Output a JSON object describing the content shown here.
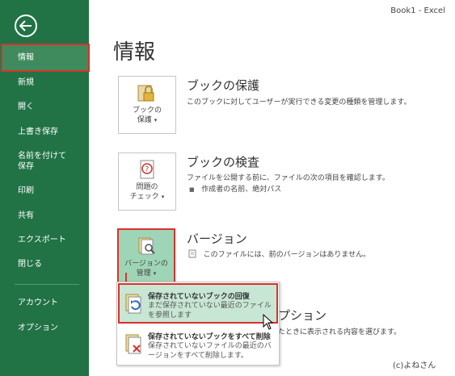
{
  "window": {
    "title": "Book1 - Excel"
  },
  "sidebar": {
    "items": [
      {
        "label": "情報"
      },
      {
        "label": "新規"
      },
      {
        "label": "開く"
      },
      {
        "label": "上書き保存"
      },
      {
        "label": "名前を付けて"
      },
      {
        "label": "保存"
      },
      {
        "label": "印刷"
      },
      {
        "label": "共有"
      },
      {
        "label": "エクスポート"
      },
      {
        "label": "閉じる"
      },
      {
        "label": "アカウント"
      },
      {
        "label": "オプション"
      }
    ]
  },
  "page": {
    "title": "情報"
  },
  "sections": {
    "protect": {
      "btn_line1": "ブックの",
      "btn_line2": "保護",
      "caret": "▾",
      "title": "ブックの保護",
      "desc": "このブックに対してユーザーが実行できる変更の種類を管理します。"
    },
    "inspect": {
      "btn_line1": "問題の",
      "btn_line2": "チェック",
      "caret": "▾",
      "title": "ブックの検査",
      "desc": "ファイルを公開する前に、ファイルの次の項目を確認します。",
      "bullet": "■",
      "detail": "作成者の名前、絶対パス"
    },
    "versions": {
      "btn_line1": "バージョンの",
      "btn_line2": "管理",
      "caret": "▾",
      "title": "バージョン",
      "desc": "このファイルには、前のバージョンはありません。"
    },
    "browser": {
      "title_partial": "プション",
      "desc_partial": "たときに表示される内容を選びます。"
    }
  },
  "menu": {
    "items": [
      {
        "title": "保存されていないブックの回復",
        "desc": "まだ保存されていない最近のファイルを参照します"
      },
      {
        "title": "保存されていないブックをすべて削除",
        "desc": "保存されていないファイルの最近のバージョンをすべて削除します。"
      }
    ]
  },
  "footer": {
    "copyright": "(c)よねさん"
  },
  "colors": {
    "sidebar": "#217346",
    "active": "#3f8b5e",
    "highlight": "#d9312c",
    "menu_highlight": "#c7e6d4"
  }
}
